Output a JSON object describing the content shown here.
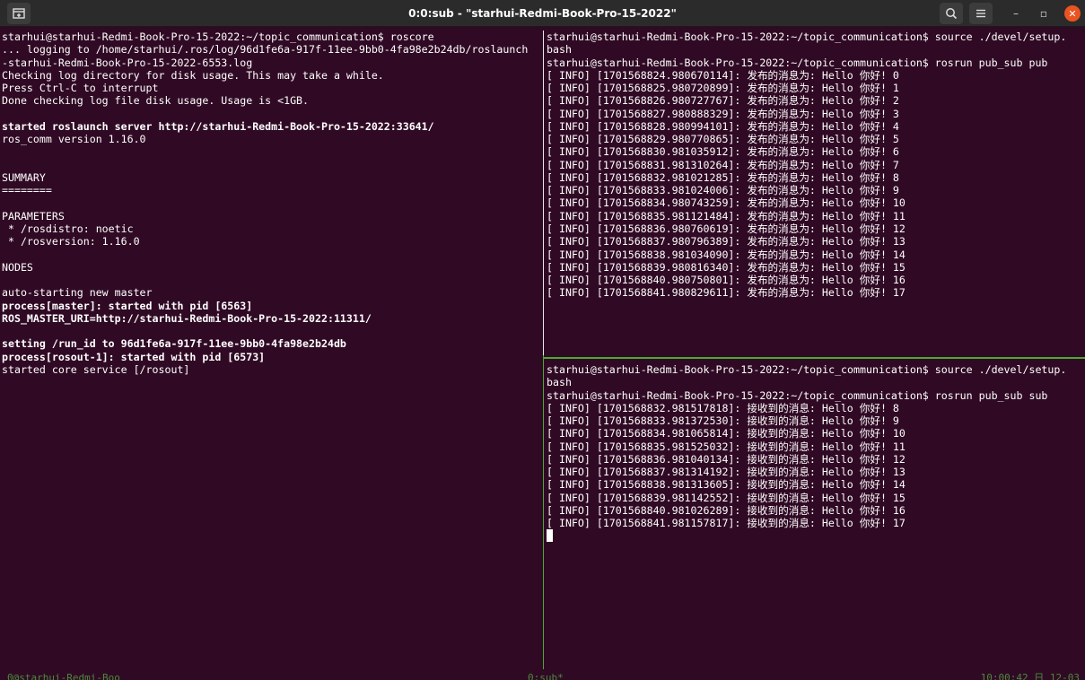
{
  "window": {
    "title": "0:0:sub - \"starhui-Redmi-Book-Pro-15-2022\"",
    "controls": {
      "minimize": "–",
      "maximize": "▫",
      "close": "✕"
    }
  },
  "panes": {
    "left": {
      "lines": [
        {
          "text": "starhui@starhui-Redmi-Book-Pro-15-2022:~/topic_communication$ roscore",
          "bold": false
        },
        {
          "text": "... logging to /home/starhui/.ros/log/96d1fe6a-917f-11ee-9bb0-4fa98e2b24db/roslaunch",
          "bold": false
        },
        {
          "text": "-starhui-Redmi-Book-Pro-15-2022-6553.log",
          "bold": false
        },
        {
          "text": "Checking log directory for disk usage. This may take a while.",
          "bold": false
        },
        {
          "text": "Press Ctrl-C to interrupt",
          "bold": false
        },
        {
          "text": "Done checking log file disk usage. Usage is <1GB.",
          "bold": false
        },
        {
          "text": "",
          "bold": false
        },
        {
          "text": "started roslaunch server http://starhui-Redmi-Book-Pro-15-2022:33641/",
          "bold": true
        },
        {
          "text": "ros_comm version 1.16.0",
          "bold": false
        },
        {
          "text": "",
          "bold": false
        },
        {
          "text": "",
          "bold": false
        },
        {
          "text": "SUMMARY",
          "bold": false
        },
        {
          "text": "========",
          "bold": false
        },
        {
          "text": "",
          "bold": false
        },
        {
          "text": "PARAMETERS",
          "bold": false
        },
        {
          "text": " * /rosdistro: noetic",
          "bold": false
        },
        {
          "text": " * /rosversion: 1.16.0",
          "bold": false
        },
        {
          "text": "",
          "bold": false
        },
        {
          "text": "NODES",
          "bold": false
        },
        {
          "text": "",
          "bold": false
        },
        {
          "text": "auto-starting new master",
          "bold": false
        },
        {
          "text": "process[master]: started with pid [6563]",
          "bold": true
        },
        {
          "text": "ROS_MASTER_URI=http://starhui-Redmi-Book-Pro-15-2022:11311/",
          "bold": true
        },
        {
          "text": "",
          "bold": false
        },
        {
          "text": "setting /run_id to 96d1fe6a-917f-11ee-9bb0-4fa98e2b24db",
          "bold": true
        },
        {
          "text": "process[rosout-1]: started with pid [6573]",
          "bold": true
        },
        {
          "text": "started core service [/rosout]",
          "bold": false
        }
      ]
    },
    "top_right": {
      "lines": [
        "starhui@starhui-Redmi-Book-Pro-15-2022:~/topic_communication$ source ./devel/setup.",
        "bash",
        "starhui@starhui-Redmi-Book-Pro-15-2022:~/topic_communication$ rosrun pub_sub pub",
        "[ INFO] [1701568824.980670114]: 发布的消息为: Hello 你好! 0",
        "[ INFO] [1701568825.980720899]: 发布的消息为: Hello 你好! 1",
        "[ INFO] [1701568826.980727767]: 发布的消息为: Hello 你好! 2",
        "[ INFO] [1701568827.980888329]: 发布的消息为: Hello 你好! 3",
        "[ INFO] [1701568828.980994101]: 发布的消息为: Hello 你好! 4",
        "[ INFO] [1701568829.980770865]: 发布的消息为: Hello 你好! 5",
        "[ INFO] [1701568830.981035912]: 发布的消息为: Hello 你好! 6",
        "[ INFO] [1701568831.981310264]: 发布的消息为: Hello 你好! 7",
        "[ INFO] [1701568832.981021285]: 发布的消息为: Hello 你好! 8",
        "[ INFO] [1701568833.981024006]: 发布的消息为: Hello 你好! 9",
        "[ INFO] [1701568834.980743259]: 发布的消息为: Hello 你好! 10",
        "[ INFO] [1701568835.981121484]: 发布的消息为: Hello 你好! 11",
        "[ INFO] [1701568836.980760619]: 发布的消息为: Hello 你好! 12",
        "[ INFO] [1701568837.980796389]: 发布的消息为: Hello 你好! 13",
        "[ INFO] [1701568838.981034090]: 发布的消息为: Hello 你好! 14",
        "[ INFO] [1701568839.980816340]: 发布的消息为: Hello 你好! 15",
        "[ INFO] [1701568840.980750801]: 发布的消息为: Hello 你好! 16",
        "[ INFO] [1701568841.980829611]: 发布的消息为: Hello 你好! 17"
      ]
    },
    "bottom_right": {
      "lines": [
        "starhui@starhui-Redmi-Book-Pro-15-2022:~/topic_communication$ source ./devel/setup.",
        "bash",
        "starhui@starhui-Redmi-Book-Pro-15-2022:~/topic_communication$ rosrun pub_sub sub",
        "[ INFO] [1701568832.981517818]: 接收到的消息: Hello 你好! 8",
        "[ INFO] [1701568833.981372530]: 接收到的消息: Hello 你好! 9",
        "[ INFO] [1701568834.981065814]: 接收到的消息: Hello 你好! 10",
        "[ INFO] [1701568835.981525032]: 接收到的消息: Hello 你好! 11",
        "[ INFO] [1701568836.981040134]: 接收到的消息: Hello 你好! 12",
        "[ INFO] [1701568837.981314192]: 接收到的消息: Hello 你好! 13",
        "[ INFO] [1701568838.981313605]: 接收到的消息: Hello 你好! 14",
        "[ INFO] [1701568839.981142552]: 接收到的消息: Hello 你好! 15",
        "[ INFO] [1701568840.981026289]: 接收到的消息: Hello 你好! 16",
        "[ INFO] [1701568841.981157817]: 接收到的消息: Hello 你好! 17"
      ]
    }
  },
  "statusbar": {
    "left": "0@starhui-Redmi-Boo",
    "middle": "0:sub*",
    "right": "10:00:42 日 12-03"
  },
  "colors": {
    "terminal_bg": "#300a24",
    "text": "#ffffff",
    "active_border": "#4aa832",
    "close_button": "#e95420"
  }
}
